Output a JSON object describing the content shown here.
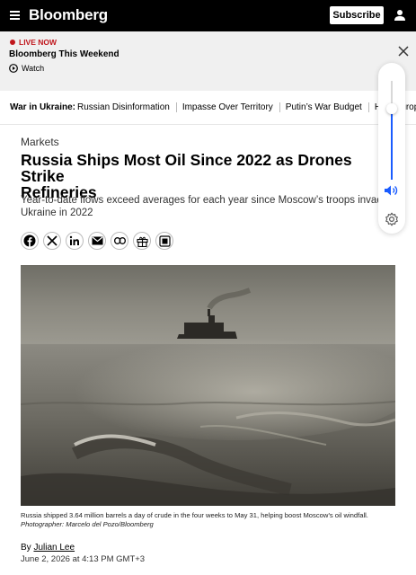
{
  "header": {
    "brand": "Bloomberg",
    "subscribe_label": "Subscribe"
  },
  "live": {
    "label": "LIVE NOW",
    "title": "Bloomberg This Weekend",
    "watch_label": "Watch"
  },
  "volume": {
    "level": 0.72
  },
  "nav": {
    "lead": "War in Ukraine:",
    "items": [
      "Russian Disinformation",
      "Impasse Over Territory",
      "Putin’s War Budget",
      "How Europe"
    ]
  },
  "article": {
    "section": "Markets",
    "headline_line1": "Russia Ships Most Oil Since 2022 as Drones Strike",
    "headline_line2": "Refineries",
    "dek_line1": "Year-to-date flows exceed averages for each year since Moscow’s troops invaded",
    "dek_line2": "Ukraine in 2022",
    "caption": "Russia shipped 3.64 million barrels a day of crude in the four weeks to May 31, helping boost Moscow’s oil windfall.",
    "photo_credit": "Photographer: Marcelo del Pozo/Bloomberg",
    "byline_prefix": "By",
    "author": "Julian Lee",
    "date": "June 2, 2026 at 4:13 PM GMT+3"
  },
  "share_icons": [
    "facebook-icon",
    "x-icon",
    "linkedin-icon",
    "email-icon",
    "link-icon",
    "gift-icon",
    "reader-icon"
  ]
}
